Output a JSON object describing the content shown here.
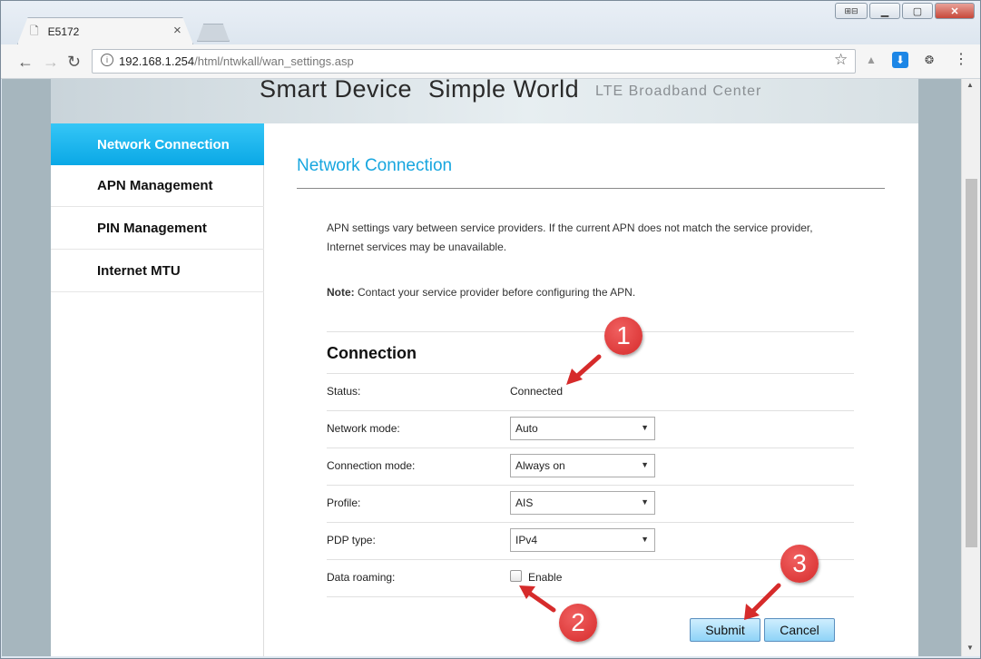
{
  "browser": {
    "tab_title": "E5172",
    "url_host": "192.168.1.254",
    "url_path": "/html/ntwkall/wan_settings.asp"
  },
  "banner": {
    "text_a": "Smart Device",
    "text_b": "Simple World",
    "subtitle": "LTE  Broadband  Center"
  },
  "sidebar": {
    "items": [
      {
        "label": "Network Connection",
        "active": true
      },
      {
        "label": "APN Management",
        "active": false
      },
      {
        "label": "PIN Management",
        "active": false
      },
      {
        "label": "Internet MTU",
        "active": false
      }
    ]
  },
  "main": {
    "title": "Network Connection",
    "intro_line1": "APN settings vary between service providers. If the current APN does not match the service provider,",
    "intro_line2": "Internet services may be unavailable.",
    "note_label": "Note:",
    "note_text": "Contact your service provider before configuring the APN.",
    "section_title": "Connection",
    "fields": {
      "status_label": "Status:",
      "status_value": "Connected",
      "network_mode_label": "Network mode:",
      "network_mode_value": "Auto",
      "connection_mode_label": "Connection mode:",
      "connection_mode_value": "Always on",
      "profile_label": "Profile:",
      "profile_value": "AIS",
      "pdp_type_label": "PDP type:",
      "pdp_type_value": "IPv4",
      "data_roaming_label": "Data roaming:",
      "data_roaming_option": "Enable"
    },
    "submit_label": "Submit",
    "cancel_label": "Cancel"
  },
  "annotations": [
    "1",
    "2",
    "3"
  ],
  "colors": {
    "accent": "#17a6df",
    "active_tab": "#0aa8e6",
    "badge": "#d62b2b"
  }
}
